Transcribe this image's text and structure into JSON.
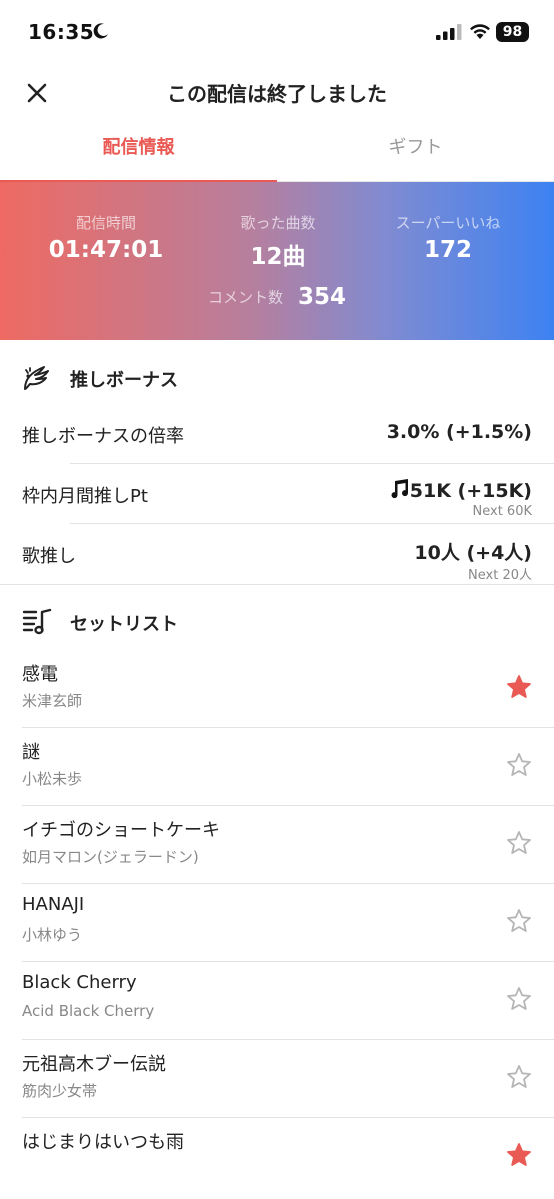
{
  "status": {
    "time": "16:35",
    "battery": "98"
  },
  "nav": {
    "title": "この配信は終了しました"
  },
  "tabs": [
    {
      "label": "配信情報",
      "active": true
    },
    {
      "label": "ギフト",
      "active": false
    }
  ],
  "stats": {
    "duration": {
      "label": "配信時間",
      "value": "01:47:01"
    },
    "songs": {
      "label": "歌った曲数",
      "value": "12曲"
    },
    "super_likes": {
      "label": "スーパーいいね",
      "value": "172"
    },
    "comments": {
      "label": "コメント数",
      "value": "354"
    }
  },
  "bonus": {
    "title": "推しボーナス",
    "rows": [
      {
        "label": "推しボーナスの倍率",
        "value": "3.0% (+1.5%)",
        "next": ""
      },
      {
        "label": "枠内月間推しPt",
        "value": "51K (+15K)",
        "next": "Next 60K"
      },
      {
        "label": "歌推し",
        "value": "10人 (+4人)",
        "next": "Next 20人"
      }
    ]
  },
  "setlist": {
    "title": "セットリスト",
    "songs": [
      {
        "title": "感電",
        "artist": "米津玄師",
        "starred": true
      },
      {
        "title": "謎",
        "artist": "小松未歩",
        "starred": false
      },
      {
        "title": "イチゴのショートケーキ",
        "artist": "如月マロン(ジェラードン)",
        "starred": false
      },
      {
        "title": "HANAJI",
        "artist": "小林ゆう",
        "starred": false
      },
      {
        "title": "Black Cherry",
        "artist": "Acid Black Cherry",
        "starred": false
      },
      {
        "title": "元祖高木ブー伝説",
        "artist": "筋肉少女帯",
        "starred": false
      },
      {
        "title": "はじまりはいつも雨",
        "artist": "",
        "starred": true
      }
    ]
  },
  "colors": {
    "accent": "#ea5a55",
    "star_on": "#ea5a55",
    "star_off": "#b5b5b5",
    "gradient_left": "#ee6a62",
    "gradient_right": "#3d82f2"
  }
}
